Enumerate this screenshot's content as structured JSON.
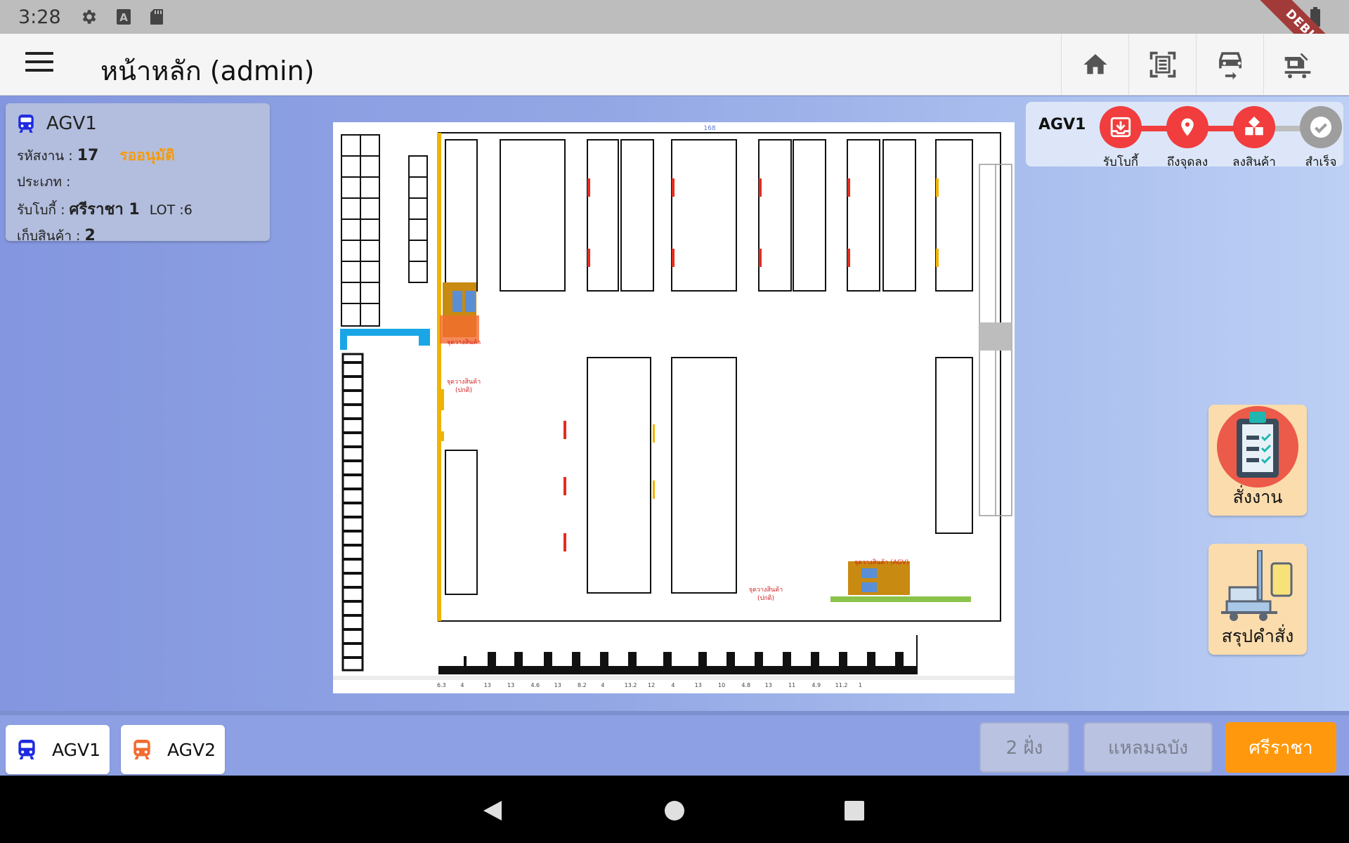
{
  "status_bar": {
    "time": "3:28",
    "icons": [
      "gear-icon",
      "keyboard-a-icon",
      "sd-card-icon",
      "wifi-icon",
      "battery-icon"
    ],
    "debug_banner": "DEBUG"
  },
  "app_bar": {
    "title": "หน้าหลัก (admin)",
    "actions": [
      "home-icon",
      "scan-icon",
      "car-sync-icon",
      "forklift-icon"
    ]
  },
  "info_card": {
    "agv_name": "AGV1",
    "job_label": "รหัสงาน : ",
    "job_value": "17",
    "job_status": "รออนุมัติ",
    "type_label": "ประเภท : ",
    "type_value": "",
    "pickup_label": "รับโบกี้ : ",
    "pickup_value": "ศรีราชา 1",
    "lot_label": "LOT :",
    "lot_value": "6",
    "store_label": "เก็บสินค้า  : ",
    "store_value": "2"
  },
  "progress": {
    "agv_name": "AGV1",
    "steps": [
      {
        "label": "รับโบกี้",
        "icon": "download-tray-icon",
        "state": "active"
      },
      {
        "label": "ถึงจุดลง",
        "icon": "location-pin-icon",
        "state": "active"
      },
      {
        "label": "ลงสินค้า",
        "icon": "boxes-icon",
        "state": "active"
      },
      {
        "label": "สำเร็จ",
        "icon": "check-icon",
        "state": "pending"
      }
    ]
  },
  "map": {
    "top_number": "168",
    "drop_label_1": "จุดวางสินค้า",
    "drop_label_2": "จุดวางสินค้า",
    "drop_label_2_sub": "(ปกติ)",
    "drop_label_3": "จุดวางสินค้า (AGV)",
    "drop_label_4": "จุดวางสินค้า",
    "drop_label_4_sub": "(ปกติ)",
    "bottom_scale": [
      "6.3",
      "4",
      "13",
      "13",
      "4.6",
      "13",
      "8.2",
      "4",
      "13.2",
      "12",
      "4",
      "13",
      "10",
      "4.8",
      "13",
      "11",
      "4.9",
      "11.2",
      "1"
    ]
  },
  "side_buttons": {
    "assign_label": "สั่งงาน",
    "summary_label": "สรุปคำสั่ง"
  },
  "bottom_bar": {
    "agv1_label": "AGV1",
    "agv2_label": "AGV2",
    "loc1": "2 ฝั่ง",
    "loc2": "แหลมฉบัง",
    "loc3": "ศรีราชา"
  },
  "colors": {
    "step_active": "#f13d3d",
    "accent_orange": "#ff980d",
    "status_pending": "#f59b0b",
    "agv1_blue": "#1f2be0",
    "agv2_orange": "#f26b2f"
  }
}
